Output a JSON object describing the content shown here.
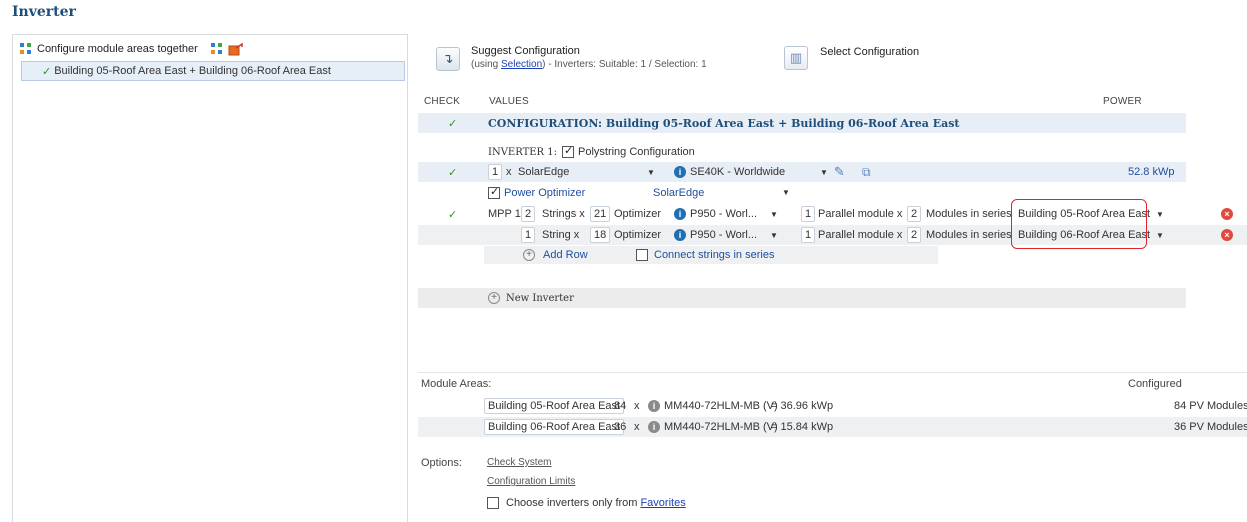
{
  "page": {
    "title": "Inverter"
  },
  "tree": {
    "root_label": "Configure module areas together",
    "selected_item": "Building 05-Roof Area East + Building 06-Roof Area East"
  },
  "toolbar": {
    "suggest_title": "Suggest Configuration",
    "suggest_using": "(using ",
    "suggest_link": "Selection",
    "suggest_rest": ") - Inverters: Suitable: 1 / Selection: 1",
    "select_title": "Select Configuration"
  },
  "table": {
    "col_check": "CHECK",
    "col_values": "VALUES",
    "col_power": "POWER",
    "configuration_label": "CONFIGURATION: Building 05-Roof Area East + Building 06-Roof Area East",
    "inverter_label": "INVERTER 1:",
    "polystring_label": "Polystring Configuration",
    "inverter": {
      "qty": "1",
      "x": "x",
      "manufacturer": "SolarEdge",
      "model": "SE40K - Worldwide",
      "power": "52.8 kWp"
    },
    "optimizer": {
      "label": "Power Optimizer",
      "manufacturer": "SolarEdge"
    },
    "mpp_label": "MPP 1:",
    "strings": [
      {
        "count": "2",
        "strings_label": "Strings x",
        "optimizers": "21",
        "optimizer_label": "Optimizer",
        "optimizer_model": "P950 - Worl...",
        "parallel": "1",
        "parallel_label": "Parallel module x",
        "series": "2",
        "series_label": "Modules in series",
        "area": "Building 05-Roof Area East"
      },
      {
        "count": "1",
        "strings_label": "String x",
        "optimizers": "18",
        "optimizer_label": "Optimizer",
        "optimizer_model": "P950 - Worl...",
        "parallel": "1",
        "parallel_label": "Parallel module x",
        "series": "2",
        "series_label": "Modules in series",
        "area": "Building 06-Roof Area East"
      }
    ],
    "add_row": "Add Row",
    "connect_series": "Connect strings in series",
    "new_inverter": "New Inverter"
  },
  "module_areas": {
    "label": "Module Areas:",
    "configured_label": "Configured",
    "rows": [
      {
        "area": "Building 05-Roof Area East",
        "count": "84",
        "x": "x",
        "module": "MM440-72HLM-MB (V)",
        "eq": "= 36.96 kWp",
        "configured": "84 PV Modules"
      },
      {
        "area": "Building 06-Roof Area East",
        "count": "36",
        "x": "x",
        "module": "MM440-72HLM-MB (V)",
        "eq": "= 15.84 kWp",
        "configured": "36 PV Modules"
      }
    ]
  },
  "options": {
    "label": "Options:",
    "check_system": "Check System",
    "config_limits": "Configuration Limits",
    "choose_prefix": "Choose inverters only from ",
    "favorites": "Favorites"
  },
  "colors": {
    "title": "#1f4e79",
    "check": "#3b8d2a",
    "highlight": "#e0242a",
    "link": "#1a3fb5"
  }
}
